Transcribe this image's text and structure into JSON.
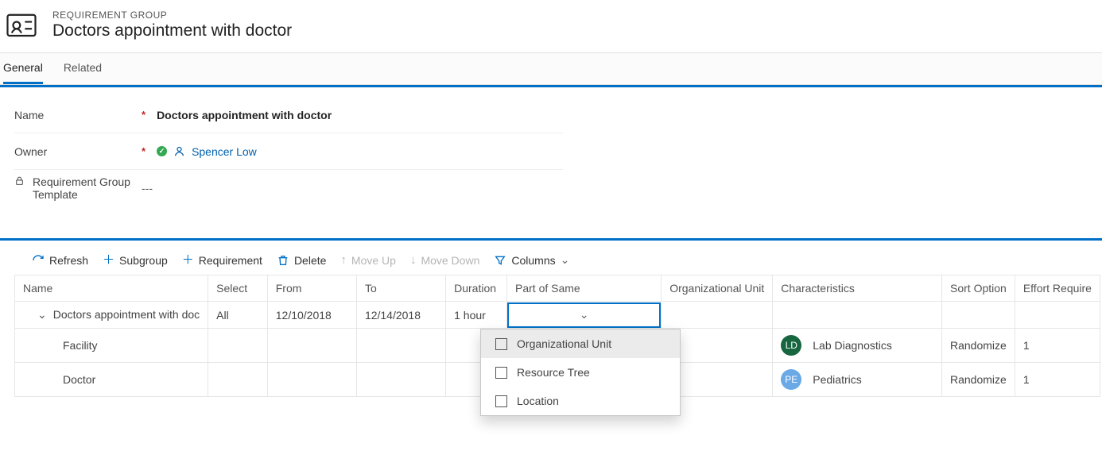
{
  "header": {
    "entity_label": "REQUIREMENT GROUP",
    "title": "Doctors appointment with doctor"
  },
  "tabs": {
    "general": "General",
    "related": "Related"
  },
  "fields": {
    "name_label": "Name",
    "name_value": "Doctors appointment with doctor",
    "owner_label": "Owner",
    "owner_value": "Spencer Low",
    "template_label": "Requirement Group Template",
    "template_value": "---"
  },
  "toolbar": {
    "refresh": "Refresh",
    "subgroup": "Subgroup",
    "requirement": "Requirement",
    "delete": "Delete",
    "moveup": "Move Up",
    "movedown": "Move Down",
    "columns": "Columns"
  },
  "grid": {
    "cols": {
      "name": "Name",
      "select": "Select",
      "from": "From",
      "to": "To",
      "duration": "Duration",
      "partofsame": "Part of Same",
      "orgunit": "Organizational Unit",
      "characteristics": "Characteristics",
      "sortoption": "Sort Option",
      "effort": "Effort Require"
    },
    "rows": {
      "parent": {
        "name": "Doctors appointment with doc",
        "select": "All",
        "from": "12/10/2018",
        "to": "12/14/2018",
        "duration": "1 hour"
      },
      "facility": {
        "name": "Facility",
        "char_badge": "LD",
        "char_badge_color": "#17663f",
        "char_label": "Lab Diagnostics",
        "sort": "Randomize",
        "effort": "1"
      },
      "doctor": {
        "name": "Doctor",
        "char_badge": "PE",
        "char_badge_color": "#6aa8e6",
        "char_label": "Pediatrics",
        "sort": "Randomize",
        "effort": "1"
      }
    }
  },
  "dropdown": {
    "opt1": "Organizational Unit",
    "opt2": "Resource Tree",
    "opt3": "Location"
  }
}
